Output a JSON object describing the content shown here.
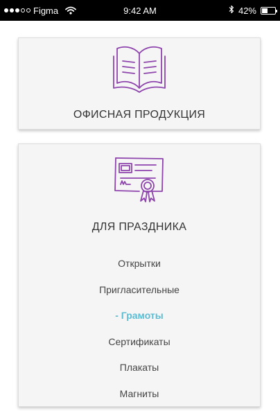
{
  "status_bar": {
    "carrier": "Figma",
    "signal_filled": 3,
    "signal_total": 5,
    "time": "9:42 AM",
    "battery_percent_text": "42%",
    "battery_level": 0.42,
    "icons": [
      "signal-dots-icon",
      "wifi-icon",
      "bluetooth-icon",
      "battery-icon"
    ]
  },
  "colors": {
    "accent": "#5bbdd4",
    "icon_stroke": "#8e44ad",
    "card_bg": "#f5f5f5",
    "text": "#333333"
  },
  "categories": [
    {
      "title": "ОФИСНАЯ ПРОДУКЦИЯ",
      "icon": "open-book-icon"
    },
    {
      "title": "ДЛЯ ПРАЗДНИКА",
      "icon": "certificate-icon",
      "items": [
        {
          "label": "Открытки",
          "active": false
        },
        {
          "label": "Пригласительные",
          "active": false
        },
        {
          "label": "- Грамоты",
          "active": true
        },
        {
          "label": "Сертификаты",
          "active": false
        },
        {
          "label": "Плакаты",
          "active": false
        },
        {
          "label": "Магниты",
          "active": false
        }
      ]
    }
  ]
}
